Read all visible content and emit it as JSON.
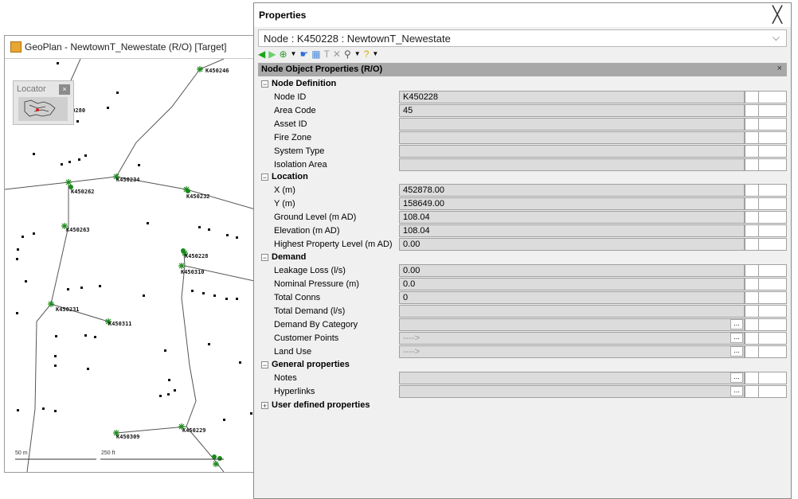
{
  "geoplan": {
    "title": "GeoPlan - NewtownT_Newestate (R/O) [Target]",
    "locator": {
      "title": "Locator",
      "close": "×"
    },
    "scale": {
      "metric": "50 m",
      "imperial": "250 ft"
    },
    "node_labels": [
      "K450246",
      "50280",
      "K450262",
      "K450234",
      "K450232",
      "K450263",
      "K450228",
      "K450310",
      "K450231",
      "K450311",
      "K450309",
      "K450229"
    ]
  },
  "properties": {
    "title": "Properties",
    "close": "╳",
    "node_selector": {
      "value": "Node : K450228 : NewtownT_Newestate",
      "chevron": "⌵"
    },
    "toolbar": {
      "icons": [
        "back-arrow-icon",
        "forward-arrow-icon",
        "target-icon",
        "dropdown-icon",
        "pointer-hand-icon",
        "grid-icon",
        "text-icon",
        "delete-icon",
        "link-icon",
        "dropdown-icon",
        "help-icon",
        "dropdown-icon"
      ]
    },
    "header": {
      "title": "Node Object Properties (R/O)",
      "close": "×"
    },
    "groups": [
      {
        "label": "Node Definition",
        "toggle": "−",
        "rows": [
          {
            "label": "Node ID",
            "value": "K450228"
          },
          {
            "label": "Area Code",
            "value": "45"
          },
          {
            "label": "Asset ID",
            "value": ""
          },
          {
            "label": "Fire Zone",
            "value": ""
          },
          {
            "label": "System Type",
            "value": ""
          },
          {
            "label": "Isolation Area",
            "value": ""
          }
        ]
      },
      {
        "label": "Location",
        "toggle": "−",
        "rows": [
          {
            "label": "X (m)",
            "value": "452878.00"
          },
          {
            "label": "Y (m)",
            "value": "158649.00"
          },
          {
            "label": "Ground Level (m AD)",
            "value": "108.04"
          },
          {
            "label": "Elevation (m AD)",
            "value": "108.04"
          },
          {
            "label": "Highest Property Level (m AD)",
            "value": "0.00"
          }
        ]
      },
      {
        "label": "Demand",
        "toggle": "−",
        "rows": [
          {
            "label": "Leakage Loss (l/s)",
            "value": "0.00"
          },
          {
            "label": "Nominal Pressure (m)",
            "value": "0.0"
          },
          {
            "label": "Total Conns",
            "value": "0"
          },
          {
            "label": "Total Demand (l/s)",
            "value": ""
          },
          {
            "label": "Demand By Category",
            "value": "",
            "button": "..."
          },
          {
            "label": "Customer Points",
            "value": "---->",
            "button": "..."
          },
          {
            "label": "Land Use",
            "value": "---->",
            "button": "..."
          }
        ]
      },
      {
        "label": "General properties",
        "toggle": "−",
        "rows": [
          {
            "label": "Notes",
            "value": "",
            "button": "..."
          },
          {
            "label": "Hyperlinks",
            "value": "",
            "button": "..."
          }
        ]
      },
      {
        "label": "User defined properties",
        "toggle": "+",
        "rows": []
      }
    ]
  },
  "colors": {
    "node_green": "#1a8a1a",
    "header_gray": "#a8a8a8",
    "field_gray": "#dcdcdc"
  }
}
